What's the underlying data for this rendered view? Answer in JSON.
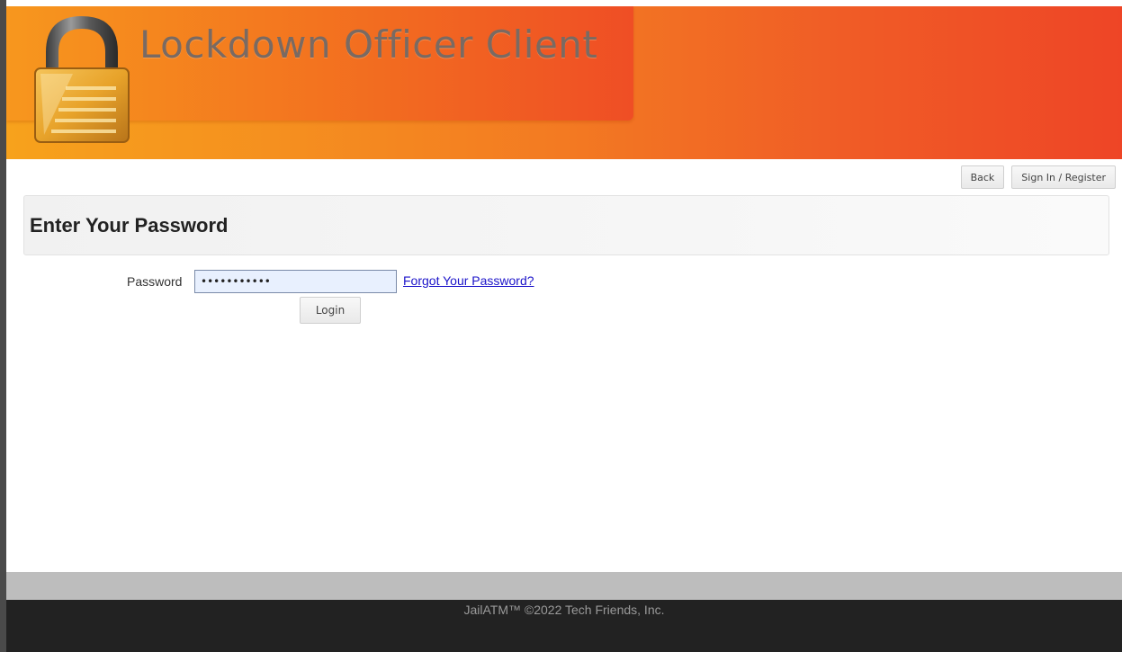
{
  "header": {
    "title": "Lockdown Officer Client",
    "logo_icon": "padlock-icon"
  },
  "nav": {
    "back_label": "Back",
    "signin_label": "Sign In / Register"
  },
  "page": {
    "title": "Enter Your Password"
  },
  "form": {
    "password_label": "Password",
    "password_value": "•••••••••••",
    "forgot_link": "Forgot Your Password?",
    "login_label": "Login"
  },
  "footer": {
    "text": "JailATM™ ©2022 Tech Friends, Inc."
  },
  "colors": {
    "banner_start": "#f7a21c",
    "banner_end": "#ee4526",
    "link": "#1a12c9",
    "footer_bg": "#222222"
  }
}
